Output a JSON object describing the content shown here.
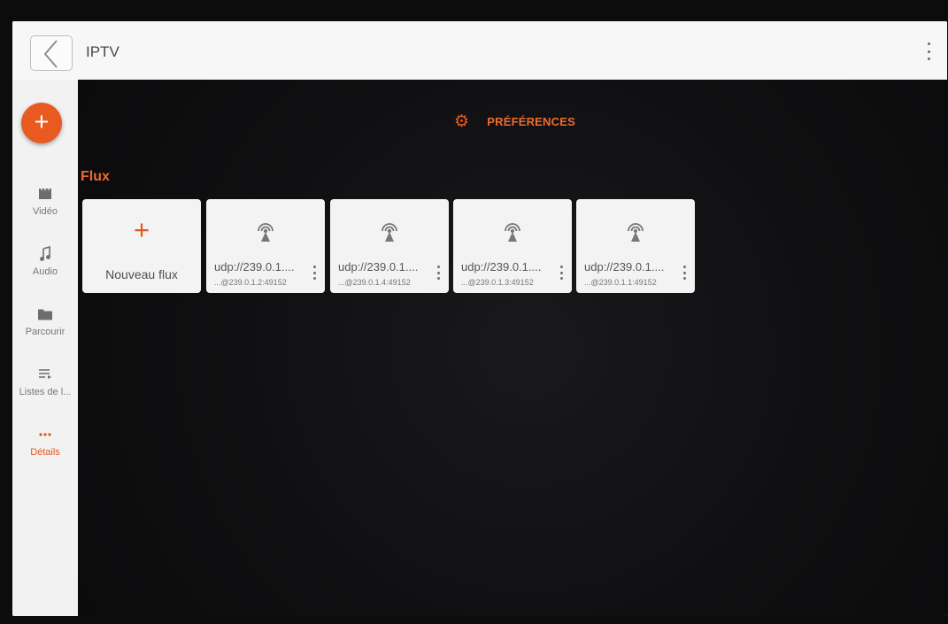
{
  "app": {
    "title": "IPTV"
  },
  "toolbar": {
    "back_icon": "back-arrow-icon",
    "menu_icon": "more-vert-icon"
  },
  "rail": {
    "fab_label": "+",
    "items": [
      {
        "label": "Vidéo",
        "icon": "video-icon"
      },
      {
        "label": "Audio",
        "icon": "music-note-icon"
      },
      {
        "label": "Parcourir",
        "icon": "folder-icon"
      },
      {
        "label": "Listes de l...",
        "icon": "playlist-icon"
      },
      {
        "label": "Détails",
        "icon": "more-horiz-icon"
      }
    ]
  },
  "main": {
    "preferences_label": "PRÉFÉRENCES",
    "section_title": "Flux",
    "new_stream_label": "Nouveau flux",
    "new_stream_plus": "+",
    "streams": [
      {
        "title": "udp://239.0.1....",
        "subtitle": "...@239.0.1.2:49152"
      },
      {
        "title": "udp://239.0.1....",
        "subtitle": "...@239.0.1.4:49152"
      },
      {
        "title": "udp://239.0.1....",
        "subtitle": "...@239.0.1.3:49152"
      },
      {
        "title": "udp://239.0.1....",
        "subtitle": "...@239.0.1.1:49152"
      }
    ]
  },
  "colors": {
    "accent": "#e85a1f",
    "main_bg": "#0f0f10",
    "surface": "#f3f3f3"
  }
}
